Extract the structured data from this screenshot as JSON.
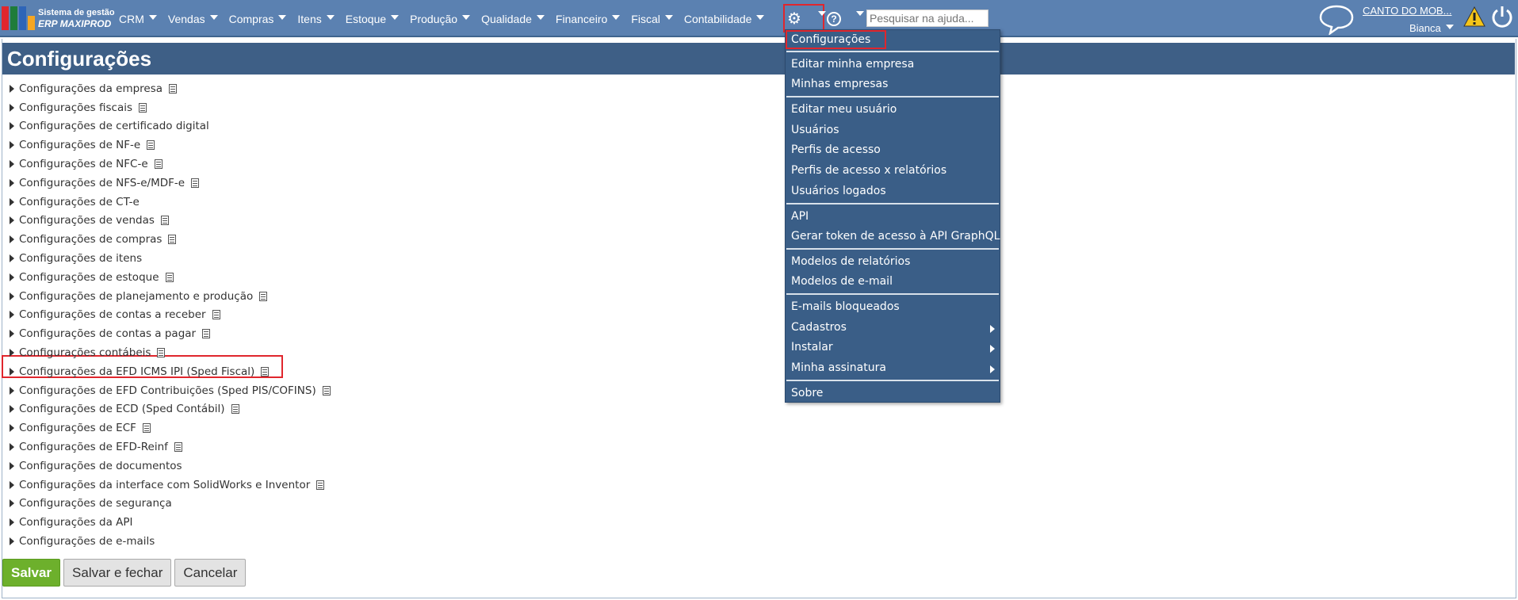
{
  "app": {
    "logo_line1": "Sistema de gestão",
    "logo_line2": "ERP MAXIPROD",
    "logo_colors": [
      "#e0262d",
      "#1f7c3a",
      "#2e65b8",
      "#f5a623"
    ]
  },
  "topnav": {
    "items": [
      {
        "label": "CRM"
      },
      {
        "label": "Vendas"
      },
      {
        "label": "Compras"
      },
      {
        "label": "Itens"
      },
      {
        "label": "Estoque"
      },
      {
        "label": "Produção"
      },
      {
        "label": "Qualidade"
      },
      {
        "label": "Financeiro"
      },
      {
        "label": "Fiscal"
      },
      {
        "label": "Contabilidade"
      }
    ],
    "search_placeholder": "Pesquisar na ajuda...",
    "company": "CANTO DO MOB...",
    "user": "Bianca"
  },
  "page": {
    "title": "Configurações",
    "items": [
      "Configurações da empresa",
      "Configurações fiscais",
      "Configurações de certificado digital",
      "Configurações de NF-e",
      "Configurações de NFC-e",
      "Configurações de NFS-e/MDF-e",
      "Configurações de CT-e",
      "Configurações de vendas",
      "Configurações de compras",
      "Configurações de itens",
      "Configurações de estoque",
      "Configurações de planejamento e produção",
      "Configurações de contas a receber",
      "Configurações de contas a pagar",
      "Configurações contábeis",
      "Configurações da EFD ICMS IPI (Sped Fiscal)",
      "Configurações de EFD Contribuições (Sped PIS/COFINS)",
      "Configurações de ECD (Sped Contábil)",
      "Configurações de ECF",
      "Configurações de EFD-Reinf",
      "Configurações de documentos",
      "Configurações da interface com SolidWorks e Inventor",
      "Configurações de segurança",
      "Configurações da API",
      "Configurações de e-mails"
    ],
    "buttons": {
      "save": "Salvar",
      "save_close": "Salvar e fechar",
      "cancel": "Cancelar"
    }
  },
  "dropdown": {
    "items": [
      "Configurações",
      "Editar minha empresa",
      "Minhas empresas",
      "Editar meu usuário",
      "Usuários",
      "Perfis de acesso",
      "Perfis de acesso x relatórios",
      "Usuários logados",
      "API",
      "Gerar token de acesso à API GraphQL",
      "Modelos de relatórios",
      "Modelos de e-mail",
      "E-mails bloqueados",
      "Cadastros",
      "Instalar",
      "Minha assinatura",
      "Sobre"
    ]
  },
  "colors": {
    "topbar": "#5b81b1",
    "title_bar": "#3e5f86",
    "dropdown_bg": "#3a5e87",
    "highlight": "#e0262d",
    "save_button": "#6db02c"
  }
}
